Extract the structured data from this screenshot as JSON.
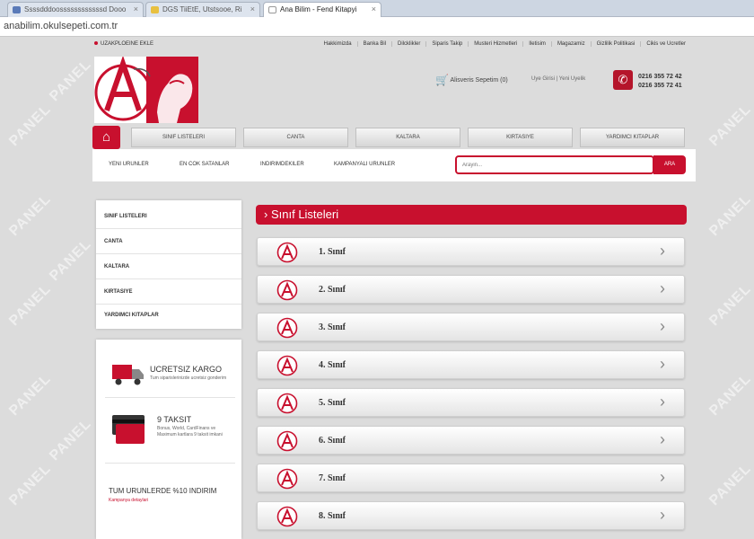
{
  "browser": {
    "tabs": [
      {
        "label": "Ssssdddoossssssssssssd Dooo",
        "icon_color": "#5a7ab8"
      },
      {
        "label": "DGS TiiEtE, Utstsooe, Ri",
        "icon_color": "#e8c040"
      },
      {
        "label": "Ana Bilim - Fend Kitapyi",
        "icon_color": "#ffffff"
      }
    ],
    "url": "anabilim.okulsepeti.com.tr"
  },
  "watermark": "PANEL",
  "top_links": {
    "left": "UZAKPLOEINE EKLE",
    "right": [
      "Hakkimizda",
      "Banka Bil",
      "Dilcklikler",
      "Siparis Takip",
      "Musteri Hizmetleri",
      "Iletisim",
      "Magazamiz",
      "Gizlilik Politikasi",
      "Cikis ve Ucretler"
    ]
  },
  "header": {
    "cart": "Alisveris Sepetim (0)",
    "login": "Uye Girisi | Yeni Uyelik",
    "phones": [
      "0216 355 72 42",
      "0216 355 72 41"
    ]
  },
  "nav": {
    "items": [
      "SINIF LISTELERI",
      "CANTA",
      "KALTARA",
      "KIRTASIYE",
      "YARDIMCI KITAPLAR"
    ]
  },
  "subnav": {
    "items": [
      "YENI URUNLER",
      "EN COK SATANLAR",
      "INDIRIMDEKILER",
      "KAMPANYALI URUNLER"
    ],
    "search_placeholder": "Arayin...",
    "search_button": "ARA"
  },
  "sidebar": {
    "items": [
      "SINIF LISTELERI",
      "CANTA",
      "KALTARA",
      "KIRTASIYE",
      "YARDIMCI KITAPLAR"
    ]
  },
  "promos": [
    {
      "title": "UCRETSIZ KARGO",
      "text": "Tum siparislerinizde ucretsiz gonderim"
    },
    {
      "title": "9 TAKSIT",
      "text": "Bonus, World, CardFinans ve Maximum kartlara 9 taksit imkani"
    },
    {
      "title": "TUM URUNLERDE %10 INDIRIM",
      "text": "Kampanya detaylari"
    }
  ],
  "main": {
    "title": "Sınıf Listeleri",
    "classes": [
      "1. Sınıf",
      "2. Sınıf",
      "3. Sınıf",
      "4. Sınıf",
      "5. Sınıf",
      "6. Sınıf",
      "7. Sınıf",
      "8. Sınıf"
    ]
  },
  "colors": {
    "accent": "#c8102e",
    "background": "#dcdcdc"
  }
}
